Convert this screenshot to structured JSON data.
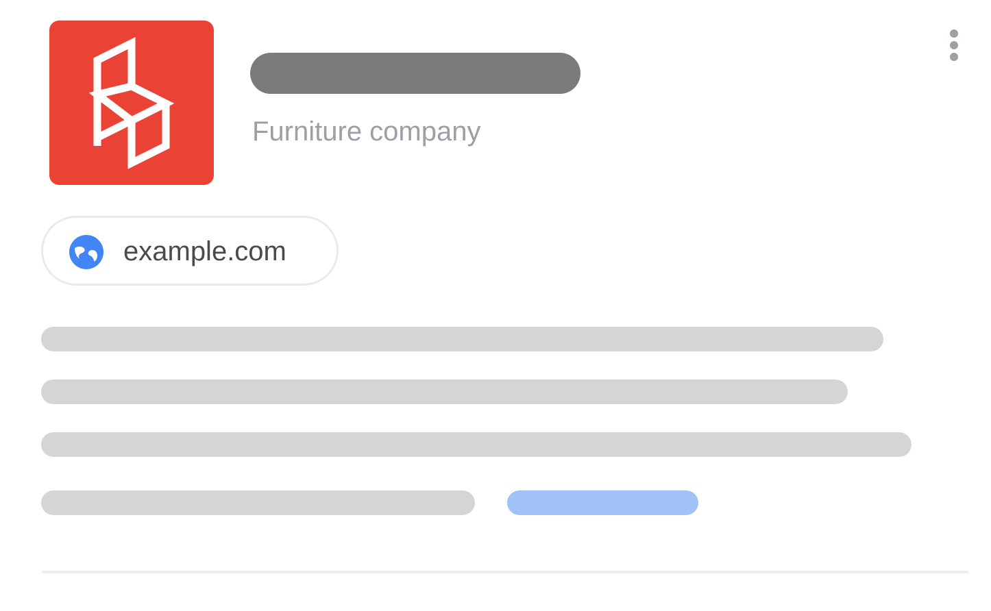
{
  "company": {
    "category": "Furniture company",
    "name_placeholder_color": "#7a7b7c"
  },
  "logo": {
    "icon": "chair-box-logo",
    "background_color": "#ea4335",
    "stroke_color": "#ffffff"
  },
  "menu": {
    "icon": "more-vertical-icon",
    "color": "#9aa0a6"
  },
  "website": {
    "url": "example.com",
    "icon": "globe-icon",
    "icon_color": "#4285f4"
  },
  "description": {
    "line_color": "#d4d5d5",
    "link_color": "#a1c2f7",
    "line_count": 4,
    "has_link_placeholder": true
  },
  "divider": {
    "color": "#eceeef"
  }
}
